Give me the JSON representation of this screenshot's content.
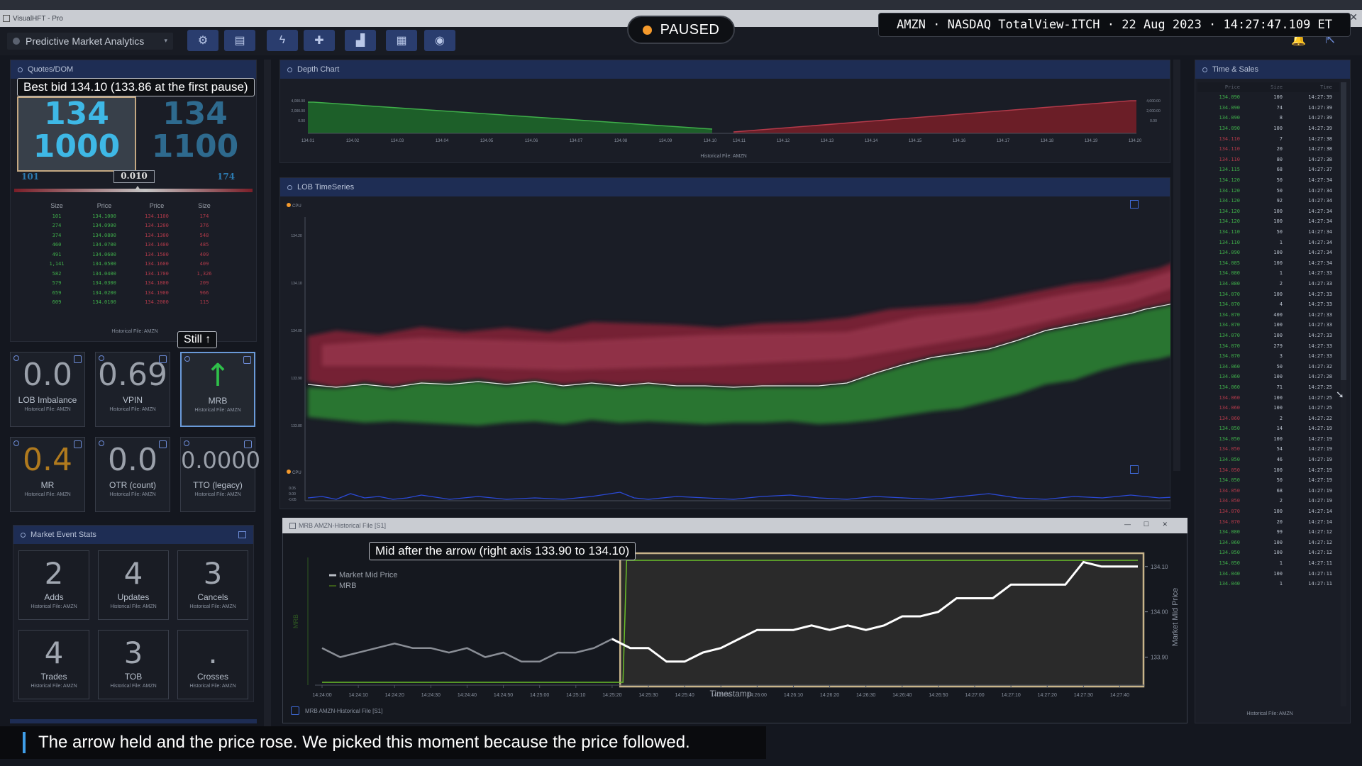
{
  "app": {
    "title": "VisualHFT - Pro",
    "close_glyph": "✕"
  },
  "toolbar": {
    "analytics_label": "Predictive Market Analytics",
    "chevron": "▾",
    "buttons": [
      {
        "icon": "gear-icon",
        "glyph": "⚙"
      },
      {
        "icon": "monitor-icon",
        "glyph": "▤"
      },
      {
        "icon": "bolt-icon",
        "glyph": "ϟ"
      },
      {
        "icon": "puzzle-icon",
        "glyph": "✚"
      },
      {
        "icon": "chart-icon",
        "glyph": "▟"
      },
      {
        "icon": "keyboard-icon",
        "glyph": "▦"
      },
      {
        "icon": "user-icon",
        "glyph": "◉"
      }
    ],
    "bell_glyph": "🔔",
    "logout_glyph": "⇱"
  },
  "status": {
    "label": "PAUSED"
  },
  "info_bar": "AMZN · NASDAQ TotalView-ITCH · 22 Aug 2023 · 14:27:47.109 ET",
  "quotes": {
    "title": "Quotes/DOM",
    "callout": "Best bid 134.10 (133.86 at the first pause)",
    "bid": {
      "price": "134",
      "size": "1000",
      "under": "101"
    },
    "ask": {
      "price": "134",
      "size": "1100",
      "under": "174"
    },
    "spread": "0.010",
    "headers": [
      "Size",
      "Price",
      "Price",
      "Size"
    ],
    "rows": [
      [
        "101",
        "134.1000",
        "134.1100",
        "174"
      ],
      [
        "274",
        "134.0900",
        "134.1200",
        "376"
      ],
      [
        "374",
        "134.0800",
        "134.1300",
        "548"
      ],
      [
        "460",
        "134.0700",
        "134.1400",
        "485"
      ],
      [
        "491",
        "134.0600",
        "134.1500",
        "409"
      ],
      [
        "1,141",
        "134.0500",
        "134.1600",
        "409"
      ],
      [
        "582",
        "134.0400",
        "134.1700",
        "1,326"
      ],
      [
        "579",
        "134.0300",
        "134.1800",
        "209"
      ],
      [
        "659",
        "134.0200",
        "134.1900",
        "966"
      ],
      [
        "609",
        "134.0100",
        "134.2000",
        "115"
      ]
    ],
    "footer": "Historical File: AMZN"
  },
  "metrics": {
    "still_callout": "Still ↑",
    "items": [
      {
        "value": "0.0",
        "label": "LOB Imbalance",
        "sub": "Historical File: AMZN"
      },
      {
        "value": "0.69",
        "label": "VPIN",
        "sub": "Historical File: AMZN"
      },
      {
        "value": "↑",
        "label": "MRB",
        "sub": "Historical File: AMZN"
      },
      {
        "value": "0.4",
        "label": "MR",
        "sub": "Historical File: AMZN"
      },
      {
        "value": "0.0",
        "label": "OTR (count)",
        "sub": "Historical File: AMZN"
      },
      {
        "value": "0.0000",
        "label": "TTO (legacy)",
        "sub": "Historical File: AMZN"
      }
    ]
  },
  "event_stats": {
    "title": "Market Event Stats",
    "items": [
      {
        "value": "2",
        "label": "Adds",
        "sub": "Historical File: AMZN"
      },
      {
        "value": "4",
        "label": "Updates",
        "sub": "Historical File: AMZN"
      },
      {
        "value": "3",
        "label": "Cancels",
        "sub": "Historical File: AMZN"
      },
      {
        "value": "4",
        "label": "Trades",
        "sub": "Historical File: AMZN"
      },
      {
        "value": "3",
        "label": "TOB",
        "sub": "Historical File: AMZN"
      },
      {
        "value": ".",
        "label": "Crosses",
        "sub": "Historical File: AMZN"
      }
    ]
  },
  "depth_chart": {
    "title": "Depth Chart",
    "bid_ticks": [
      "134.01",
      "134.02",
      "134.03",
      "134.04",
      "134.05",
      "134.06",
      "134.07",
      "134.08",
      "134.09",
      "134.10"
    ],
    "ask_ticks": [
      "134.11",
      "134.12",
      "134.13",
      "134.14",
      "134.15",
      "134.16",
      "134.17",
      "134.18",
      "134.19",
      "134.20"
    ],
    "y_ticks": [
      "4,000.00",
      "2,000.00",
      "0.00"
    ],
    "footer": "Historical File: AMZN"
  },
  "lob_timeseries": {
    "title": "LOB TimeSeries",
    "top_tag": "CPU",
    "bottom_tag": "CPU",
    "y_ticks": [
      "134.20",
      "134.10",
      "134.00",
      "133.90",
      "133.80"
    ],
    "bottom_y_ticks": [
      "0.05",
      "0.00",
      "-0.05"
    ]
  },
  "mrb_window": {
    "title": "MRB AMZN-Historical File [S1]",
    "footer": "MRB AMZN-Historical File [S1]",
    "callout": "Mid after the arrow (right axis 133.90 to 134.10)",
    "legend": [
      "Market Mid Price",
      "MRB"
    ],
    "left_axis_label": "MRB",
    "right_axis_label": "Market Mid Price",
    "x_label": "Timestamp",
    "x_ticks": [
      "14:24:00",
      "14:24:10",
      "14:24:20",
      "14:24:30",
      "14:24:40",
      "14:24:50",
      "14:25:00",
      "14:25:10",
      "14:25:20",
      "14:25:30",
      "14:25:40",
      "14:25:50",
      "14:26:00",
      "14:26:10",
      "14:26:20",
      "14:26:30",
      "14:26:40",
      "14:26:50",
      "14:27:00",
      "14:27:10",
      "14:27:20",
      "14:27:30",
      "14:27:40"
    ],
    "window_controls": [
      "—",
      "☐",
      "✕"
    ]
  },
  "chart_data": {
    "type": "line",
    "title": "",
    "xlabel": "Timestamp",
    "ylabel": "Market Mid Price",
    "ylim": [
      133.86,
      134.12
    ],
    "highlight_start": "14:25:23",
    "series": [
      {
        "name": "Market Mid Price",
        "x": [
          "14:24:00",
          "14:24:05",
          "14:24:10",
          "14:24:15",
          "14:24:20",
          "14:24:25",
          "14:24:30",
          "14:24:35",
          "14:24:40",
          "14:24:45",
          "14:24:50",
          "14:24:55",
          "14:25:00",
          "14:25:05",
          "14:25:10",
          "14:25:15",
          "14:25:20",
          "14:25:25",
          "14:25:30",
          "14:25:35",
          "14:25:40",
          "14:25:45",
          "14:25:50",
          "14:25:55",
          "14:26:00",
          "14:26:05",
          "14:26:10",
          "14:26:15",
          "14:26:20",
          "14:26:25",
          "14:26:30",
          "14:26:35",
          "14:26:40",
          "14:26:45",
          "14:26:50",
          "14:26:55",
          "14:27:00",
          "14:27:05",
          "14:27:10",
          "14:27:15",
          "14:27:20",
          "14:27:25",
          "14:27:30",
          "14:27:35",
          "14:27:40",
          "14:27:45"
        ],
        "y": [
          133.92,
          133.9,
          133.91,
          133.92,
          133.93,
          133.92,
          133.92,
          133.91,
          133.92,
          133.9,
          133.91,
          133.89,
          133.89,
          133.91,
          133.91,
          133.92,
          133.94,
          133.92,
          133.92,
          133.89,
          133.89,
          133.91,
          133.92,
          133.94,
          133.96,
          133.96,
          133.96,
          133.97,
          133.96,
          133.97,
          133.96,
          133.97,
          133.99,
          133.99,
          134.0,
          134.03,
          134.03,
          134.03,
          134.06,
          134.06,
          134.06,
          134.06,
          134.11,
          134.1,
          134.1,
          134.1
        ]
      },
      {
        "name": "MRB",
        "x": [
          "14:24:00",
          "14:25:23",
          "14:25:24",
          "14:27:45"
        ],
        "y": [
          0,
          0,
          1,
          1
        ]
      }
    ]
  },
  "time_sales": {
    "title": "Time & Sales",
    "headers": [
      "Price",
      "Size",
      "Time"
    ],
    "rows": [
      [
        "134.090",
        "100",
        "14:27:39",
        "g"
      ],
      [
        "134.090",
        "74",
        "14:27:39",
        "g"
      ],
      [
        "134.090",
        "8",
        "14:27:39",
        "g"
      ],
      [
        "134.090",
        "100",
        "14:27:39",
        "g"
      ],
      [
        "134.110",
        "7",
        "14:27:38",
        "r"
      ],
      [
        "134.110",
        "20",
        "14:27:38",
        "r"
      ],
      [
        "134.110",
        "80",
        "14:27:38",
        "r"
      ],
      [
        "134.115",
        "68",
        "14:27:37",
        "g"
      ],
      [
        "134.120",
        "50",
        "14:27:34",
        "g"
      ],
      [
        "134.120",
        "50",
        "14:27:34",
        "g"
      ],
      [
        "134.120",
        "92",
        "14:27:34",
        "g"
      ],
      [
        "134.120",
        "100",
        "14:27:34",
        "g"
      ],
      [
        "134.120",
        "100",
        "14:27:34",
        "g"
      ],
      [
        "134.110",
        "50",
        "14:27:34",
        "g"
      ],
      [
        "134.110",
        "1",
        "14:27:34",
        "g"
      ],
      [
        "134.090",
        "100",
        "14:27:34",
        "g"
      ],
      [
        "134.085",
        "100",
        "14:27:34",
        "g"
      ],
      [
        "134.080",
        "1",
        "14:27:33",
        "g"
      ],
      [
        "134.080",
        "2",
        "14:27:33",
        "g"
      ],
      [
        "134.070",
        "100",
        "14:27:33",
        "g"
      ],
      [
        "134.070",
        "4",
        "14:27:33",
        "g"
      ],
      [
        "134.070",
        "400",
        "14:27:33",
        "g"
      ],
      [
        "134.070",
        "100",
        "14:27:33",
        "g"
      ],
      [
        "134.070",
        "100",
        "14:27:33",
        "g"
      ],
      [
        "134.070",
        "279",
        "14:27:33",
        "g"
      ],
      [
        "134.070",
        "3",
        "14:27:33",
        "g"
      ],
      [
        "134.060",
        "50",
        "14:27:32",
        "g"
      ],
      [
        "134.060",
        "100",
        "14:27:28",
        "g"
      ],
      [
        "134.060",
        "71",
        "14:27:25",
        "g"
      ],
      [
        "134.060",
        "100",
        "14:27:25",
        "r"
      ],
      [
        "134.060",
        "100",
        "14:27:25",
        "r"
      ],
      [
        "134.060",
        "2",
        "14:27:22",
        "r"
      ],
      [
        "134.050",
        "14",
        "14:27:19",
        "g"
      ],
      [
        "134.050",
        "100",
        "14:27:19",
        "g"
      ],
      [
        "134.050",
        "54",
        "14:27:19",
        "r"
      ],
      [
        "134.050",
        "46",
        "14:27:19",
        "g"
      ],
      [
        "134.050",
        "100",
        "14:27:19",
        "r"
      ],
      [
        "134.050",
        "50",
        "14:27:19",
        "g"
      ],
      [
        "134.050",
        "68",
        "14:27:19",
        "r"
      ],
      [
        "134.050",
        "2",
        "14:27:19",
        "r"
      ],
      [
        "134.070",
        "100",
        "14:27:14",
        "r"
      ],
      [
        "134.070",
        "20",
        "14:27:14",
        "r"
      ],
      [
        "134.080",
        "99",
        "14:27:12",
        "g"
      ],
      [
        "134.060",
        "100",
        "14:27:12",
        "g"
      ],
      [
        "134.050",
        "100",
        "14:27:12",
        "g"
      ],
      [
        "134.050",
        "1",
        "14:27:11",
        "g"
      ],
      [
        "134.040",
        "100",
        "14:27:11",
        "g"
      ],
      [
        "134.040",
        "1",
        "14:27:11",
        "g"
      ]
    ],
    "footer": "Historical File: AMZN"
  },
  "caption": "The arrow held and the price rose. We picked this moment because the price followed.",
  "colors": {
    "bid_green": "#3fae4a",
    "ask_red": "#b23a4a",
    "accent_blue": "#1e2d54",
    "paused_dot": "#f59a2c",
    "mrb_line": "#6bbf2a",
    "mid_line": "#ffffff"
  }
}
